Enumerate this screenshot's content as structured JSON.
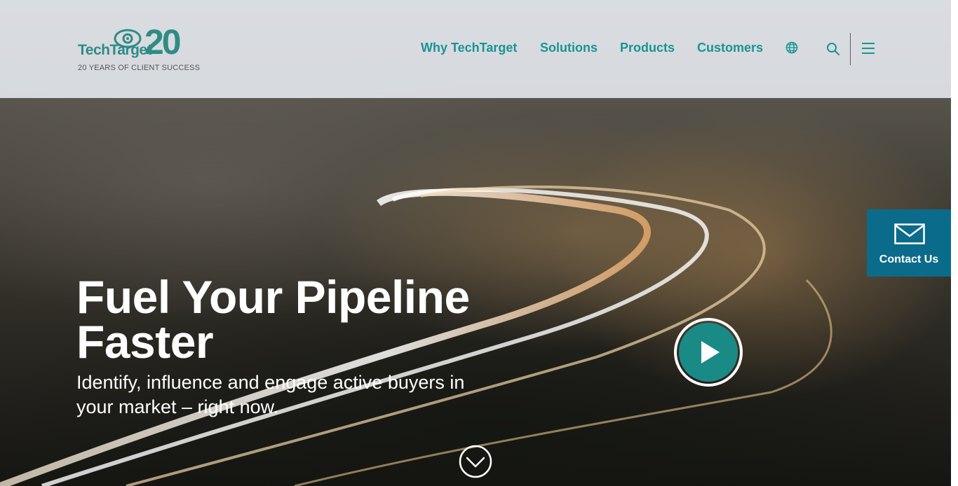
{
  "brand": {
    "name": "TechTarget",
    "anniversary": "20",
    "tagline": "20 YEARS OF CLIENT SUCCESS",
    "color": "#2f8c85"
  },
  "nav": {
    "items": [
      {
        "label": "Why TechTarget"
      },
      {
        "label": "Solutions"
      },
      {
        "label": "Products"
      },
      {
        "label": "Customers"
      }
    ],
    "icons": [
      "globe-icon",
      "search-icon",
      "menu-icon"
    ],
    "link_color": "#1a9590"
  },
  "hero": {
    "title": "Fuel Your Pipeline Faster",
    "subtitle": "Identify, influence and engage active buyers in your market – right now."
  },
  "contact": {
    "label": "Contact Us",
    "icon": "envelope-icon",
    "color": "#0b6b8a"
  },
  "controls": {
    "play_icon": "play-icon",
    "scroll_icon": "chevron-down-icon"
  }
}
